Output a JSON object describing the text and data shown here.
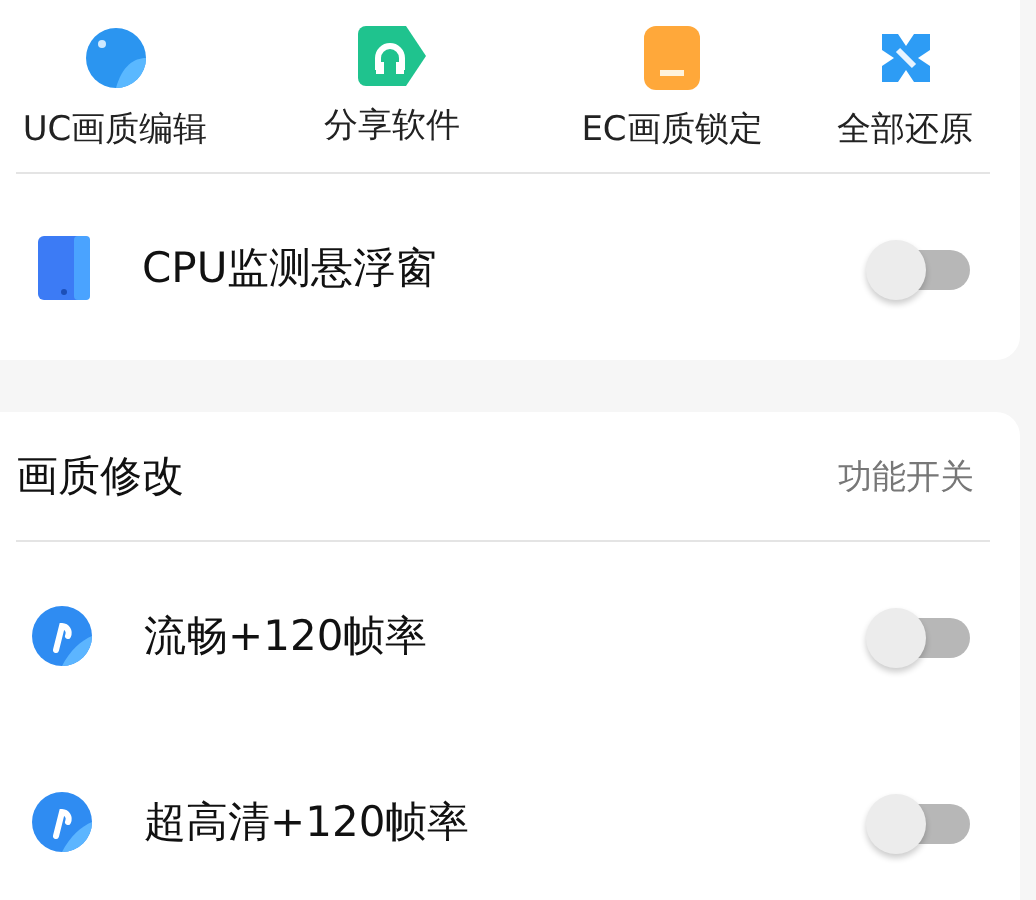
{
  "tools": [
    {
      "label": "UC画质编辑",
      "kind": "sphere"
    },
    {
      "label": "分享软件",
      "kind": "headset"
    },
    {
      "label": "EC画质锁定",
      "kind": "note"
    },
    {
      "label": "全部还原",
      "kind": "cross"
    }
  ],
  "monitor": {
    "label": "CPU监测悬浮窗",
    "on": false
  },
  "section": {
    "title": "画质修改",
    "subtitle": "功能开关",
    "rows": [
      {
        "label": "流畅+120帧率",
        "on": false
      },
      {
        "label": "超高清+120帧率",
        "on": false
      }
    ]
  }
}
